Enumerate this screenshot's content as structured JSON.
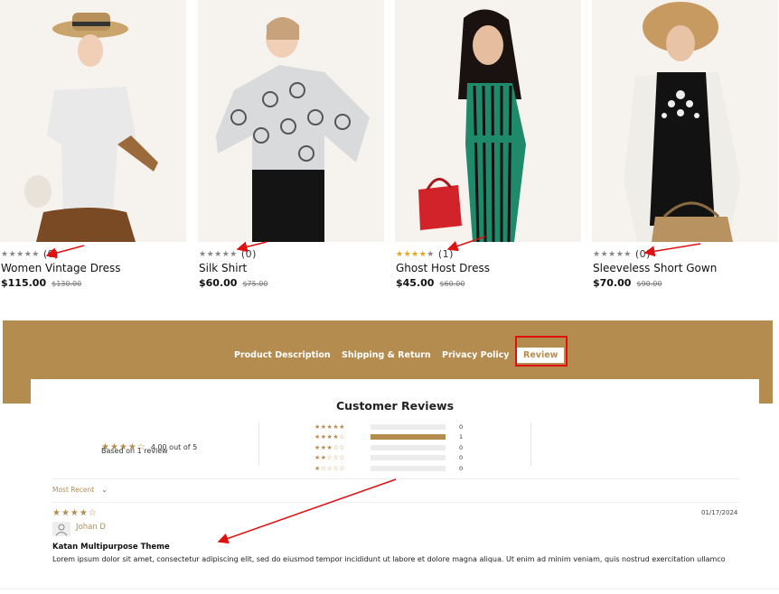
{
  "products": [
    {
      "name": "Women Vintage Dress",
      "price": "$115.00",
      "old_price": "$130.00",
      "rating": 0,
      "rating_count": "(0)"
    },
    {
      "name": "Silk Shirt",
      "price": "$60.00",
      "old_price": "$75.00",
      "rating": 0,
      "rating_count": "(0)"
    },
    {
      "name": "Ghost Host Dress",
      "price": "$45.00",
      "old_price": "$60.00",
      "rating": 4,
      "rating_count": "(1)"
    },
    {
      "name": "Sleeveless Short Gown",
      "price": "$70.00",
      "old_price": "$90.00",
      "rating": 0,
      "rating_count": "(0)"
    }
  ],
  "tabs": [
    {
      "label": "Product Description"
    },
    {
      "label": "Shipping & Return"
    },
    {
      "label": "Privacy Policy"
    },
    {
      "label": "Review"
    }
  ],
  "reviews": {
    "title": "Customer Reviews",
    "average_text": "4.00 out of 5",
    "based_on": "Based on 1 review",
    "average_rating": 4,
    "distribution": [
      {
        "stars": 5,
        "count": "0",
        "fraction": 0
      },
      {
        "stars": 4,
        "count": "1",
        "fraction": 1
      },
      {
        "stars": 3,
        "count": "0",
        "fraction": 0
      },
      {
        "stars": 2,
        "count": "0",
        "fraction": 0
      },
      {
        "stars": 1,
        "count": "0",
        "fraction": 0
      }
    ],
    "sort_label": "Most Recent",
    "items": [
      {
        "rating": 4,
        "author": "Johan D",
        "date": "01/17/2024",
        "title": "Katan Multipurpose Theme",
        "body": "Lorem ipsum dolor sit amet, consectetur adipiscing elit, sed do eiusmod tempor incididunt ut labore et dolore magna aliqua. Ut enim ad minim veniam, quis nostrud exercitation ullamco"
      }
    ]
  },
  "colors": {
    "accent": "#b58c50",
    "star_gold": "#e8a21c",
    "annotation_red": "#e01010",
    "image_bg": "#f6f3ee"
  },
  "icons": [
    "star-icon",
    "chevron-down-icon",
    "user-icon"
  ],
  "footer_fragment": "clipped"
}
